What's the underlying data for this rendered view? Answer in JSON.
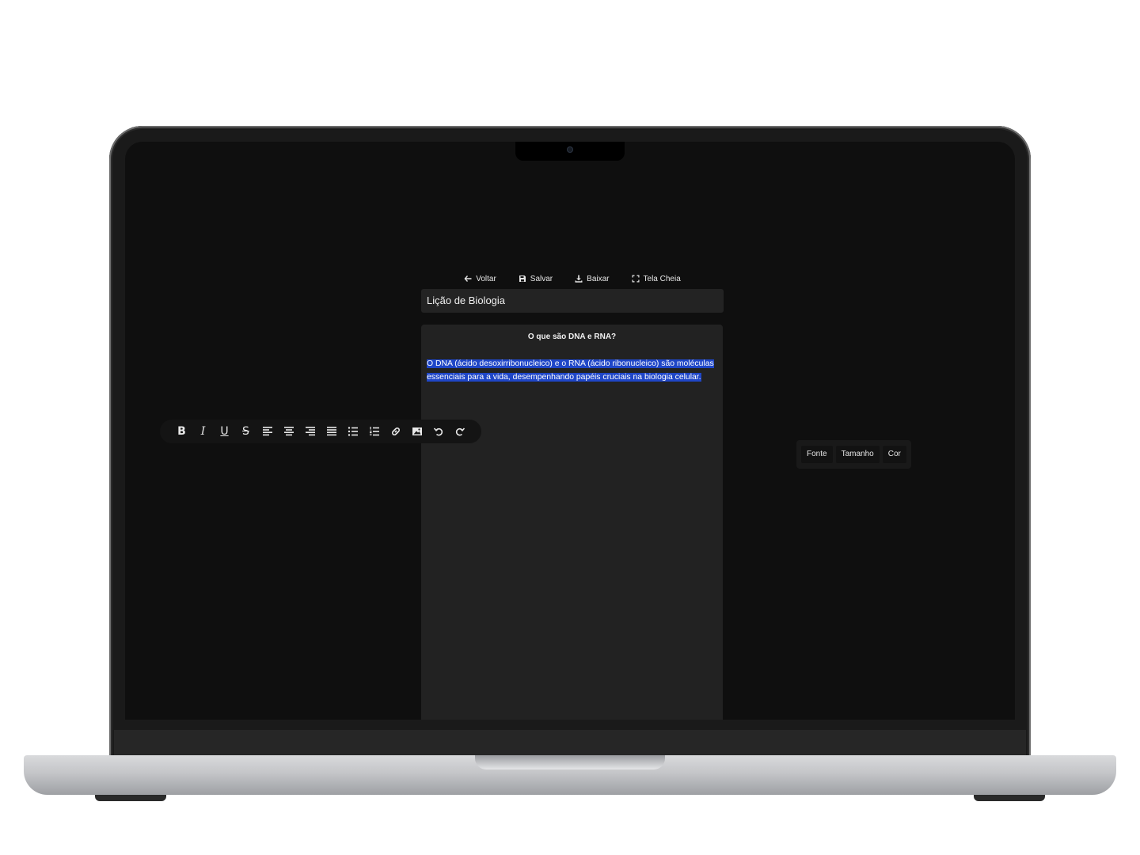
{
  "actions": {
    "back": "Voltar",
    "save": "Salvar",
    "download": "Baixar",
    "fullscreen": "Tela Cheia"
  },
  "document": {
    "title": "Lição de Biologia",
    "heading": "O que são DNA e RNA?",
    "body": "O DNA (ácido desoxirribonucleico) e o RNA (ácido ribonucleico) são moléculas essenciais para a vida, desempenhando papéis cruciais na biologia celular.",
    "selection_color": "#1f46c7"
  },
  "toolbar": {
    "bold": "B",
    "italic": "I",
    "underline": "U",
    "strike": "S",
    "icons": [
      "bold-icon",
      "italic-icon",
      "underline-icon",
      "strikethrough-icon",
      "align-left-icon",
      "align-center-icon",
      "align-right-icon",
      "align-justify-icon",
      "bullet-list-icon",
      "numbered-list-icon",
      "link-icon",
      "image-icon",
      "undo-icon",
      "redo-icon"
    ]
  },
  "side_panel": {
    "font": "Fonte",
    "size": "Tamanho",
    "color": "Cor"
  },
  "theme": {
    "background": "#0f0f0f",
    "surface": "#222222",
    "text": "#ffffff"
  }
}
